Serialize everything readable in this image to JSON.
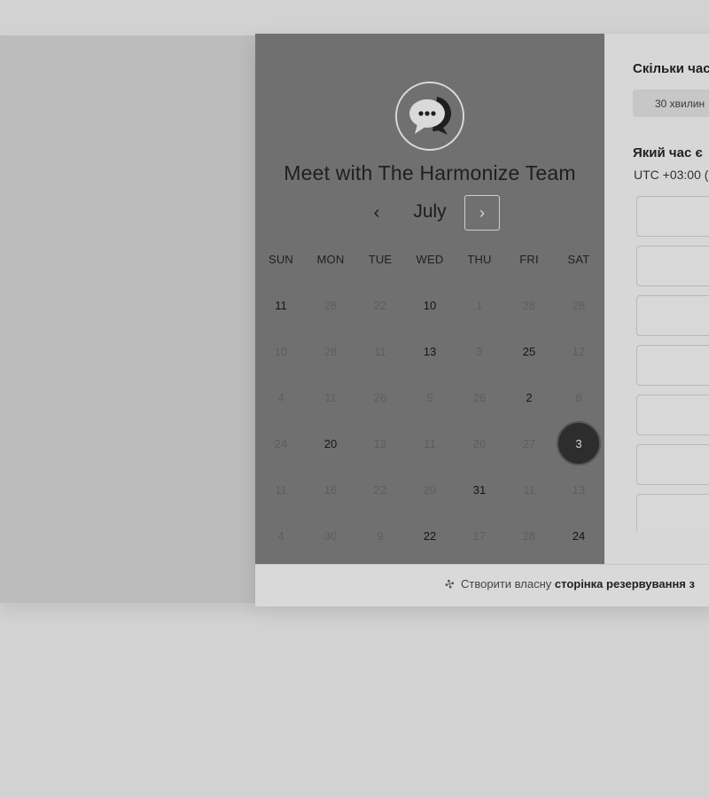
{
  "title": "Meet with The Harmonize Team",
  "month": "July",
  "navigation": {
    "prev_symbol": "‹",
    "next_symbol": "›"
  },
  "weekdays": [
    "SUN",
    "MON",
    "TUE",
    "WED",
    "THU",
    "FRI",
    "SAT"
  ],
  "calendar": {
    "rows": [
      [
        "11",
        "28",
        "22",
        "10",
        "1",
        "28",
        "28"
      ],
      [
        "10",
        "28",
        "11",
        "13",
        "3",
        "25",
        "12"
      ],
      [
        "4",
        "11",
        "26",
        "5",
        "26",
        "2",
        "8"
      ],
      [
        "24",
        "20",
        "13",
        "11",
        "26",
        "27",
        "3"
      ],
      [
        "11",
        "16",
        "22",
        "29",
        "31",
        "11",
        "13"
      ],
      [
        "4",
        "30",
        "9",
        "22",
        "17",
        "28",
        "24"
      ]
    ],
    "active_days": [
      [
        0,
        0
      ],
      [
        0,
        3
      ],
      [
        1,
        3
      ],
      [
        1,
        5
      ],
      [
        2,
        5
      ],
      [
        3,
        1
      ],
      [
        3,
        6
      ],
      [
        4,
        4
      ],
      [
        5,
        3
      ],
      [
        5,
        6
      ]
    ],
    "selected_day": [
      3,
      6
    ]
  },
  "right_panel": {
    "duration_heading": "Скільки час",
    "duration_option": "30 хвилин",
    "time_heading": "Який час є",
    "timezone": "UTC +03:00 ("
  },
  "footer": {
    "prefix": "Створити власну",
    "bold": "сторінка резервування з"
  },
  "colors": {
    "calendar_bg": "#707070",
    "selected_day_bg": "#2d2d2d",
    "page_bg": "#d2d2d2"
  },
  "icons": {
    "logo": "chat-bubble-icon",
    "footer": "hubspot-sprocket-icon"
  }
}
